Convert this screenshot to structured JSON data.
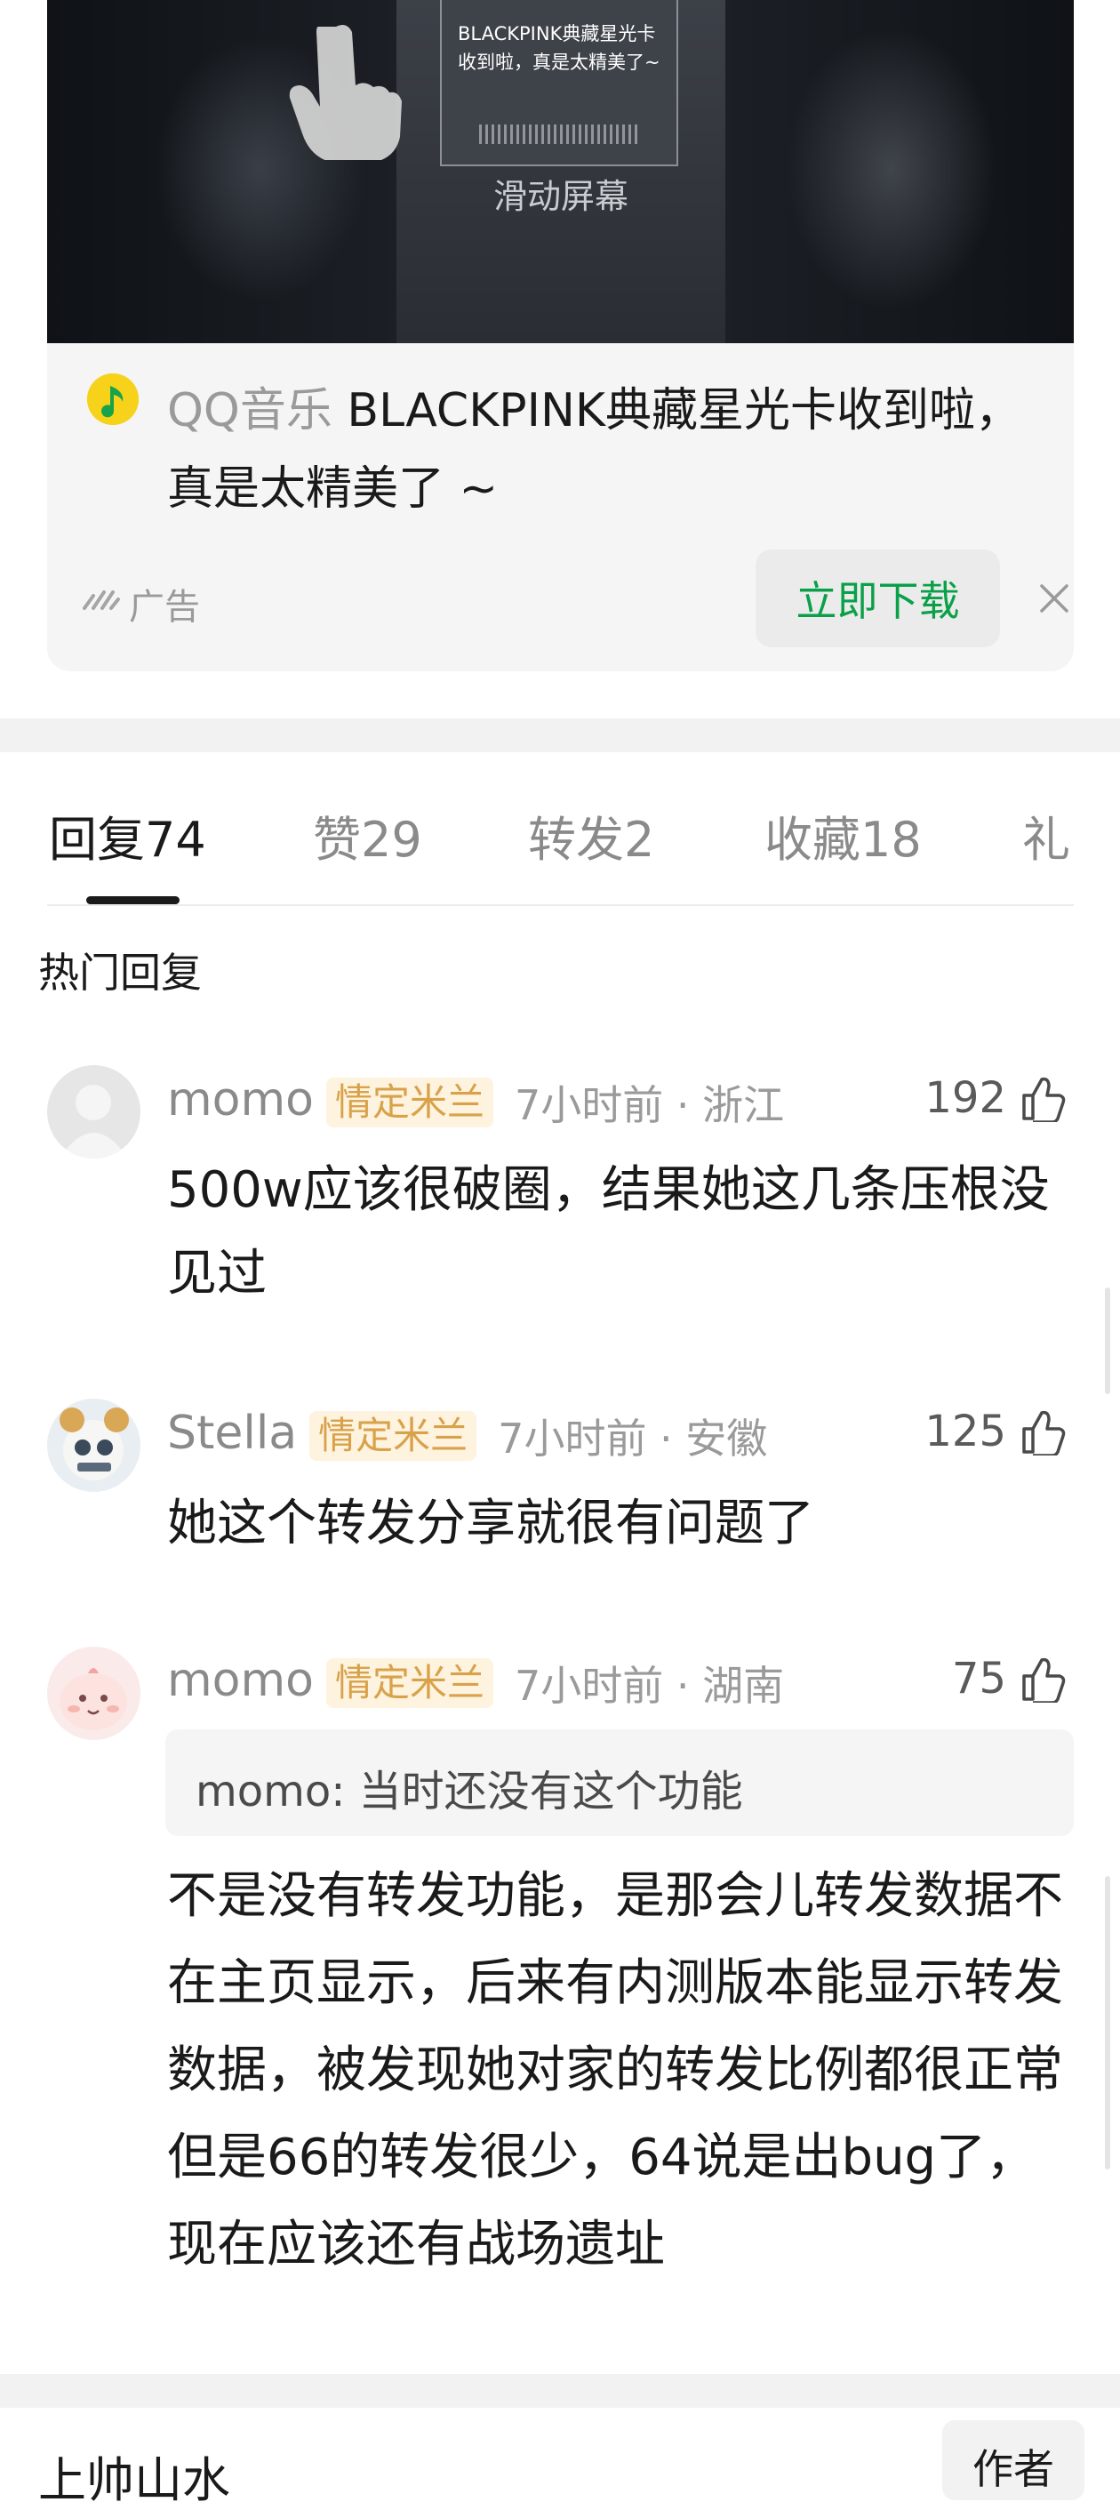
{
  "ad": {
    "ticket_text": "BLACKPINK典藏星光卡收到啦，真是太精美了~",
    "swipe_hint": "滑动屏幕",
    "app_name": "QQ音乐",
    "headline": "QQ音乐 BLACKPINK典藏星光卡收到啦，真是太精美了 ~",
    "label": "广告",
    "download_button": "立即下载",
    "icons": [
      "hand-pointer-icon",
      "qq-music-icon",
      "ad-mark-icon",
      "close-icon"
    ],
    "accent_color": "#0aa049"
  },
  "tabs": [
    {
      "label": "回复",
      "count": "74",
      "active": true
    },
    {
      "label": "赞",
      "count": "29",
      "active": false
    },
    {
      "label": "转发",
      "count": "2",
      "active": false
    },
    {
      "label": "收藏",
      "count": "18",
      "active": false
    },
    {
      "label": "礼",
      "count": "",
      "active": false
    }
  ],
  "section_title": "热门回复",
  "comments": [
    {
      "user": "momo",
      "badge": "情定米兰",
      "meta": "7小时前 · 浙江",
      "likes": "192",
      "body": "500w应该很破圈，结果她这几条压根没见过"
    },
    {
      "user": "Stella",
      "badge": "情定米兰",
      "meta": "7小时前 · 安徽",
      "likes": "125",
      "body": "她这个转发分享就很有问题了"
    },
    {
      "user": "momo",
      "badge": "情定米兰",
      "meta": "7小时前 · 湖南",
      "likes": "75",
      "quote": "momo: 当时还没有这个功能",
      "body": "不是没有转发功能，是那会儿转发数据不在主页显示，后来有内测版本能显示转发数据，被发现她对家的转发比例都很正常但是66的转发很少，64说是出bug了，现在应该还有战场遗址"
    }
  ],
  "bottom": {
    "partial_text": "上帅山水",
    "author_button": "作者"
  }
}
